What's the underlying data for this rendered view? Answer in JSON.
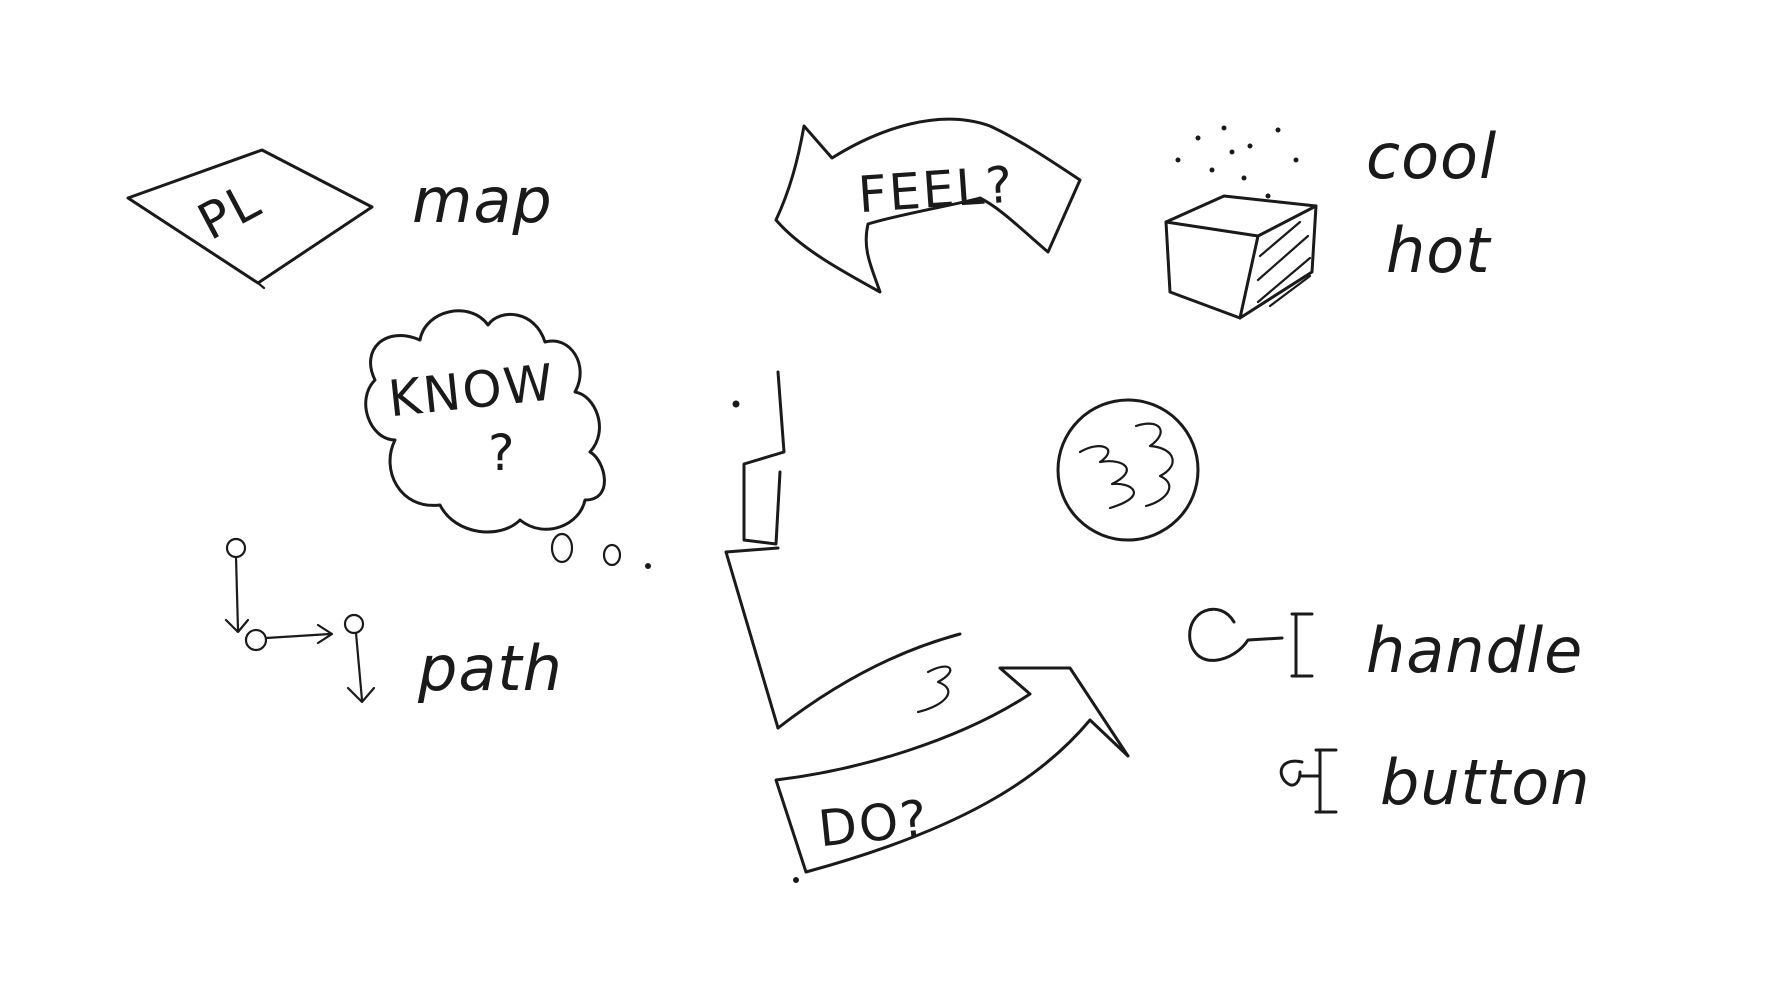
{
  "sketch": {
    "map": {
      "label": "map",
      "inner": "PL"
    },
    "know": {
      "label": "KNOW",
      "question": "?"
    },
    "path": {
      "label": "path"
    },
    "feel": {
      "label": "FEEL?"
    },
    "cool_hot": {
      "cool": "cool",
      "hot": "hot"
    },
    "do": {
      "label": "DO?"
    },
    "handle": {
      "label": "handle"
    },
    "button": {
      "label": "button"
    }
  }
}
